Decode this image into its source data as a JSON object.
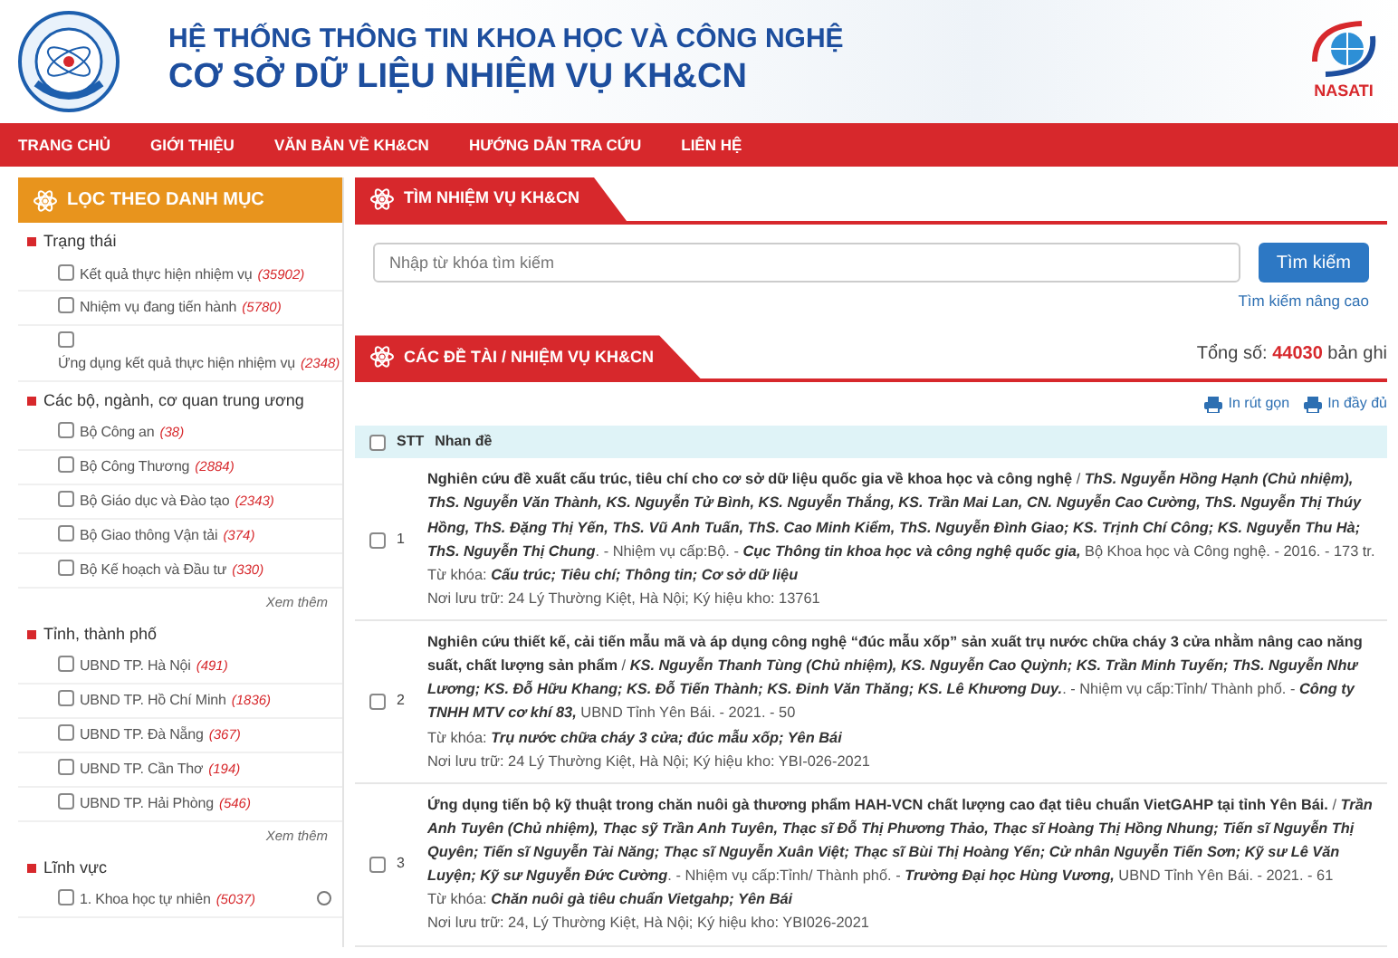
{
  "header": {
    "line1": "HỆ THỐNG THÔNG TIN KHOA HỌC VÀ CÔNG NGHỆ",
    "line2": "CƠ SỞ DỮ LIỆU NHIỆM VỤ KH&CN",
    "logo_right": "NASATI"
  },
  "nav": [
    "TRANG CHỦ",
    "GIỚI THIỆU",
    "VĂN BẢN VỀ KH&CN",
    "HƯỚNG DẪN TRA CỨU",
    "LIÊN HỆ"
  ],
  "sidebar": {
    "title": "LỌC THEO DANH MỤC",
    "groups": [
      {
        "title": "Trạng thái",
        "items": [
          {
            "label": "Kết quả thực hiện nhiệm vụ",
            "count": "(35902)",
            "checked": false
          },
          {
            "label": "Nhiệm vụ đang tiến hành",
            "count": "(5780)",
            "checked": false
          },
          {
            "label": "Ứng dụng kết quả thực hiện nhiệm vụ",
            "count": "(2348)",
            "checked": false
          }
        ]
      },
      {
        "title": "Các bộ, ngành, cơ quan trung ương",
        "items": [
          {
            "label": "Bộ Công an",
            "count": "(38)",
            "checked": false
          },
          {
            "label": "Bộ Công Thương",
            "count": "(2884)",
            "checked": false
          },
          {
            "label": "Bộ Giáo dục và Đào tạo",
            "count": "(2343)",
            "checked": false
          },
          {
            "label": "Bộ Giao thông Vận tải",
            "count": "(374)",
            "checked": false
          },
          {
            "label": "Bộ Kế hoạch và Đầu tư",
            "count": "(330)",
            "checked": false
          }
        ],
        "more": "Xem thêm"
      },
      {
        "title": "Tỉnh, thành phố",
        "items": [
          {
            "label": "UBND TP. Hà Nội",
            "count": "(491)",
            "checked": false
          },
          {
            "label": "UBND TP. Hồ Chí Minh",
            "count": "(1836)",
            "checked": false
          },
          {
            "label": "UBND TP. Đà Nẵng",
            "count": "(367)",
            "checked": false
          },
          {
            "label": "UBND TP. Cần Thơ",
            "count": "(194)",
            "checked": false
          },
          {
            "label": "UBND TP. Hải Phòng",
            "count": "(546)",
            "checked": false
          }
        ],
        "more": "Xem thêm"
      },
      {
        "title": "Lĩnh vực",
        "items": [
          {
            "label": "1. Khoa học tự nhiên",
            "count": "(5037)",
            "checked": false,
            "expandable": true
          }
        ]
      }
    ]
  },
  "search": {
    "title": "TÌM NHIỆM VỤ KH&CN",
    "placeholder": "Nhập từ khóa tìm kiếm",
    "button": "Tìm kiếm",
    "advanced": "Tìm kiếm nâng cao"
  },
  "results": {
    "title": "CÁC ĐỀ TÀI / NHIỆM VỤ KH&CN",
    "total_label": "Tổng số:",
    "total": "44030",
    "total_unit": "bản ghi",
    "print_short": "In rút gọn",
    "print_full": "In đầy đủ",
    "select_all_checked": false,
    "columns": [
      "STT",
      "Nhan đề"
    ],
    "rows": [
      {
        "stt": "1",
        "checked": false,
        "description": "**Nghiên cứu đề xuất cấu trúc, tiêu chí cho cơ sở dữ liệu quốc gia về khoa học và công nghệ** / *ThS. Nguyễn Hồng Hạnh (Chủ nhiệm), ThS. Nguyễn Văn Thành, KS. Nguyễn Tử Bình, KS. Nguyễn Thắng, KS. Trần Mai Lan, CN. Nguyễn Cao Cường, ThS. Nguyễn Thị Thúy Hồng, ThS. Đặng Thị Yến, ThS. Vũ Anh Tuấn, ThS. Cao Minh Kiểm, ThS. Nguyễn Đình Giao; KS. Trịnh Chí Công; KS. Nguyễn Thu Hà; ThS. Nguyễn Thị Chung*. - Nhiệm vụ cấp:Bộ. - *Cục Thông tin khoa học và công nghệ quốc gia,* Bộ Khoa học và Công nghệ. - 2016. - 173 tr.",
        "keywords": "Từ khóa: *Cấu trúc; Tiêu chí; Thông tin; Cơ sở dữ liệu*",
        "storage": "Nơi lưu trữ: 24 Lý Thường Kiệt, Hà Nội; Ký hiệu kho: 13761"
      },
      {
        "stt": "2",
        "checked": false,
        "description": "**Nghiên cứu thiết kế, cải tiến mẫu mã và áp dụng công nghệ “đúc mẫu xốp” sản xuất trụ nước chữa cháy 3 cửa nhằm nâng cao năng suất, chất lượng sản phẩm** / *KS. Nguyễn Thanh Tùng (Chủ nhiệm), KS. Nguyễn Cao Quỳnh; KS. Trần Minh Tuyến; ThS. Nguyễn Như Lương; KS. Đỗ Hữu Khang; KS. Đỗ Tiến Thành; KS. Đinh Văn Thăng; KS. Lê Khương Duy.*. - Nhiệm vụ cấp:Tỉnh/ Thành phố. - *Công ty TNHH MTV cơ khí 83,* UBND Tỉnh Yên Bái. - 2021. - 50",
        "keywords": "Từ khóa: *Trụ nước chữa cháy 3 cửa; đúc mẫu xốp; Yên Bái*",
        "storage": "Nơi lưu trữ: 24 Lý Thường Kiệt, Hà Nội; Ký hiệu kho: YBI-026-2021"
      },
      {
        "stt": "3",
        "checked": false,
        "description": "**Ứng dụng tiến bộ kỹ thuật trong chăn nuôi gà thương phẩm HAH-VCN chất lượng cao đạt tiêu chuẩn VietGAHP tại tỉnh Yên Bái.** / *Trần Anh Tuyên (Chủ nhiệm), Thạc sỹ Trần Anh Tuyên, Thạc sĩ Đỗ Thị Phương Thảo, Thạc sĩ Hoàng Thị Hồng Nhung; Tiến sĩ Nguyễn Thị Quyên; Tiến sĩ Nguyễn Tài Năng; Thạc sĩ Nguyễn Xuân Việt; Thạc sĩ Bùi Thị Hoàng Yến; Cử nhân Nguyễn Tiến Sơn; Kỹ sư Lê Văn Luyện; Kỹ sư Nguyễn Đức Cường*. - Nhiệm vụ cấp:Tỉnh/ Thành phố. - *Trường Đại học Hùng Vương,* UBND Tỉnh Yên Bái. - 2021. - 61",
        "keywords": "Từ khóa: *Chăn nuôi gà tiêu chuẩn Vietgahp; Yên Bái*",
        "storage": "Nơi lưu trữ: 24, Lý Thường Kiệt, Hà Nội; Ký hiệu kho: YBI026-2021"
      }
    ]
  }
}
